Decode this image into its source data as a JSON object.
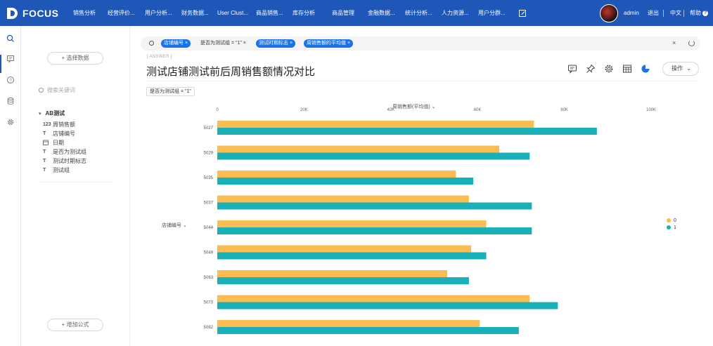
{
  "app": {
    "logo_text": "FOCUS",
    "nav": [
      "销售分析",
      "经营评价...",
      "用户分析...",
      "财务数据...",
      "User Clust...",
      "商品销售...",
      "库存分析",
      "商品管理",
      "金融数据...",
      "统计分析...",
      "人力资源...",
      "用户分群..."
    ],
    "user": "admin",
    "logout": "退出",
    "language": "中文",
    "help": "帮助",
    "help_mark": "?"
  },
  "panel": {
    "select_data": "选择数据",
    "search_placeholder": "搜索关键词",
    "group": "AB测试",
    "fields": [
      {
        "type": "123",
        "name": "周销售额"
      },
      {
        "type": "T",
        "name": "店铺编号"
      },
      {
        "type": "date",
        "name": "日期"
      },
      {
        "type": "T",
        "name": "是否为测试组"
      },
      {
        "type": "T",
        "name": "测试时期标志"
      },
      {
        "type": "T",
        "name": "测试组"
      }
    ],
    "add_formula": "增加公式"
  },
  "filters": [
    {
      "label": "店铺编号",
      "style": "blue"
    },
    {
      "label": "是否为测试组 = \"1\"",
      "style": "plain"
    },
    {
      "label": "测试时期标志",
      "style": "blue"
    },
    {
      "label": "周销售额的平均值",
      "style": "blue"
    }
  ],
  "main": {
    "answer_label": "[ ANSWER ]",
    "title": "测试店铺测试前后周销售额情况对比",
    "operate": "操作",
    "condition_tag": "是否为测试组 = \"1\""
  },
  "colors": {
    "brand": "#1f57b8",
    "series0": "#fbbd52",
    "series1": "#1ab0b8"
  },
  "chart_data": {
    "type": "bar",
    "orientation": "horizontal",
    "x_axis_label": "周销售额(平均值)",
    "y_axis_label": "店铺编号",
    "x_ticks": [
      "0",
      "20K",
      "40K",
      "60K",
      "80K",
      "100K"
    ],
    "xlim": [
      0,
      100000
    ],
    "categories": [
      "5027",
      "5029",
      "5035",
      "5037",
      "5044",
      "5049",
      "5063",
      "5073",
      "5082"
    ],
    "series": [
      {
        "name": "0",
        "values": [
          73000,
          65000,
          55000,
          58000,
          62000,
          58500,
          53000,
          72000,
          60500
        ]
      },
      {
        "name": "1",
        "values": [
          87500,
          72000,
          59000,
          72500,
          72500,
          62000,
          58000,
          78500,
          69500
        ]
      }
    ],
    "legend_position": "right",
    "grid": false
  }
}
